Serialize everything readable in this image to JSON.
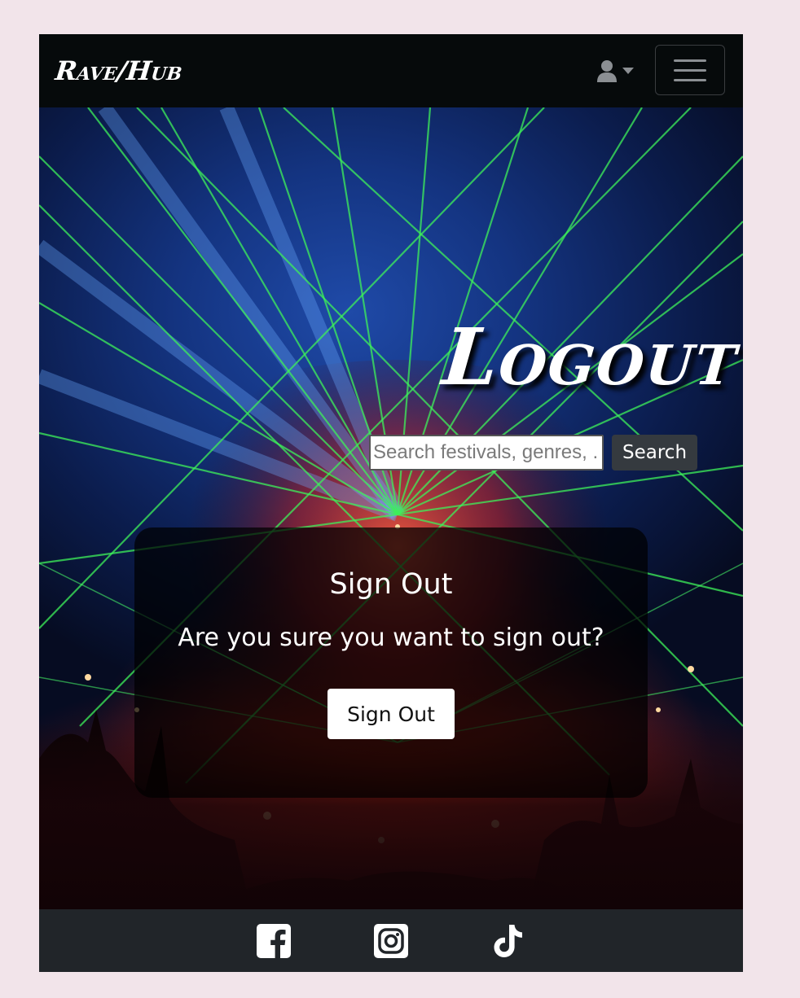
{
  "navbar": {
    "brand": "Rave/Hub",
    "user_menu_icon": "user-icon",
    "user_menu_caret": "caret-down-icon",
    "menu_toggle_icon": "hamburger-icon"
  },
  "hero": {
    "heading": "Logout",
    "search": {
      "placeholder": "Search festivals, genres, ...",
      "button_label": "Search"
    }
  },
  "card": {
    "title": "Sign Out",
    "message": "Are you sure you want to sign out?",
    "button_label": "Sign Out"
  },
  "footer": {
    "social": [
      {
        "name": "facebook-icon"
      },
      {
        "name": "instagram-icon"
      },
      {
        "name": "tiktok-icon"
      }
    ]
  },
  "colors": {
    "page_background": "#f2e4ea",
    "navbar": "#060a0b",
    "footer": "#212529",
    "search_button": "#353a3f"
  }
}
